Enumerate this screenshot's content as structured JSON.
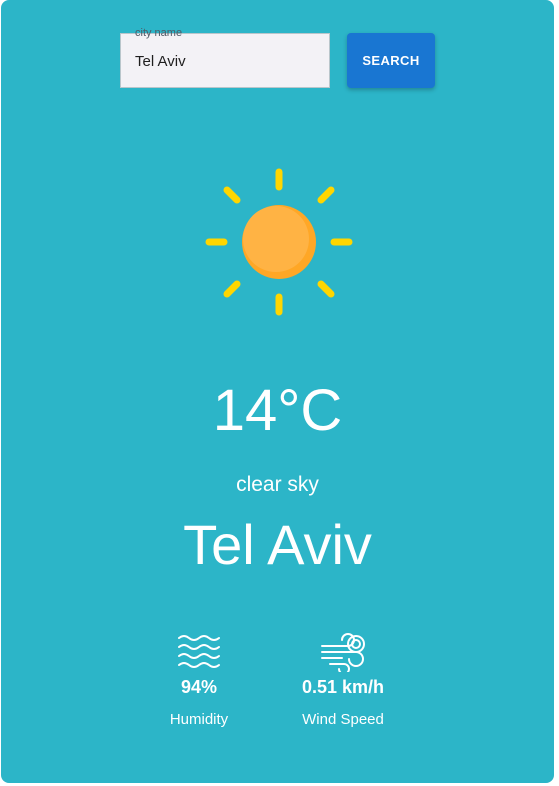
{
  "search": {
    "label": "city name",
    "value": "Tel Aviv",
    "button_label": "SEARCH"
  },
  "weather": {
    "icon": "sun-icon",
    "temperature": "14°C",
    "description": "clear sky",
    "city": "Tel Aviv"
  },
  "stats": {
    "humidity": {
      "icon": "waves-icon",
      "value": "94%",
      "label": "Humidity"
    },
    "wind": {
      "icon": "wind-icon",
      "value": "0.51 km/h",
      "label": "Wind Speed"
    }
  },
  "colors": {
    "background": "#2cb5c8",
    "button": "#1976d2",
    "sun": "#ffab40",
    "sun_rays": "#ffd600"
  }
}
